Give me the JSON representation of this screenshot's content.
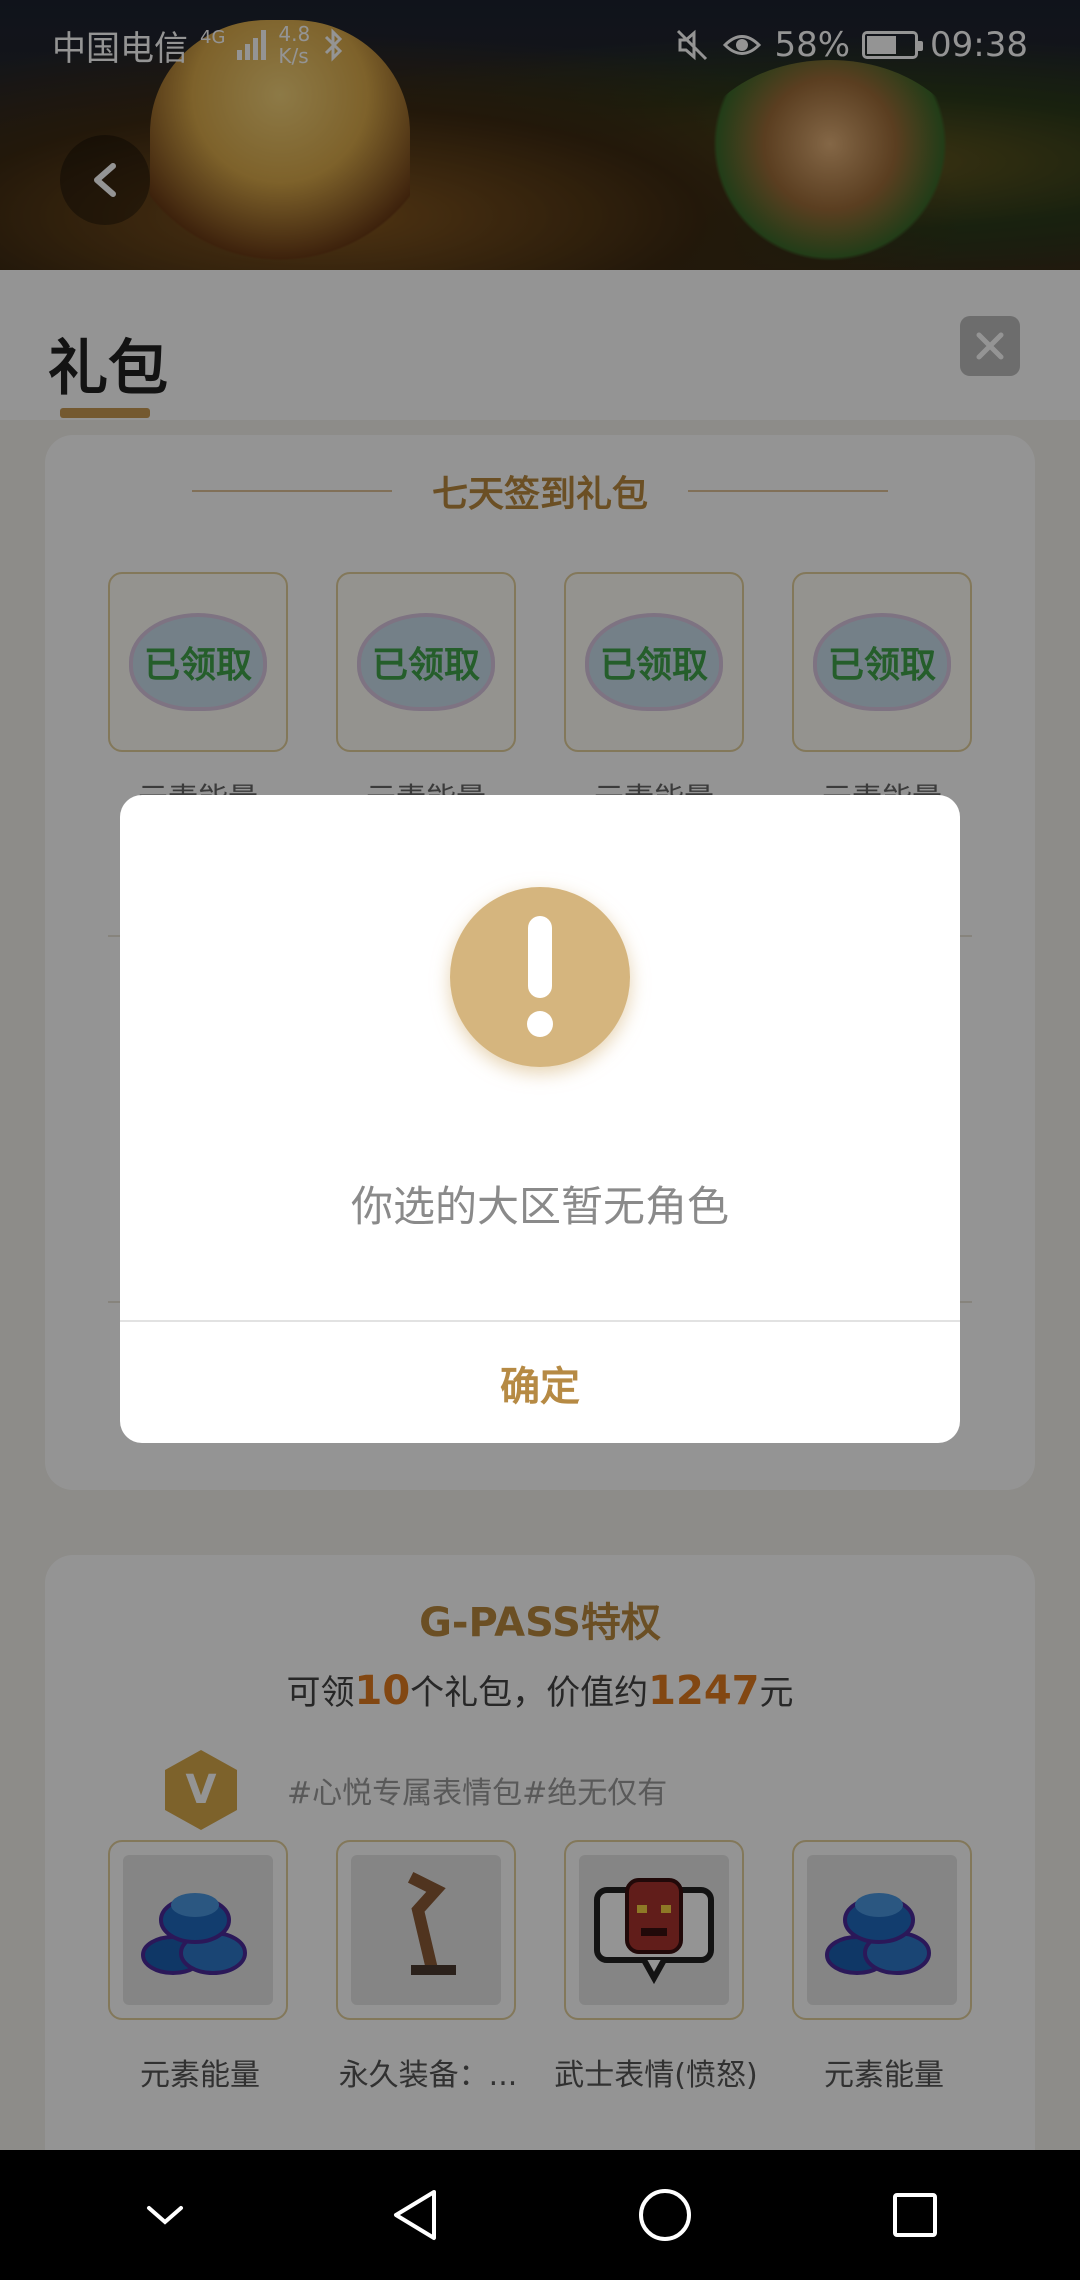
{
  "status_bar": {
    "carrier": "中国电信",
    "network_type": "4G",
    "net_speed_value": "4.8",
    "net_speed_unit": "K/s",
    "battery_percent": "58%",
    "battery_level": 0.58,
    "time": "09:38"
  },
  "sheet": {
    "title": "礼包"
  },
  "signin_section": {
    "title": "七天签到礼包",
    "rewards": [
      {
        "status": "已领取",
        "caption": "元素能量"
      },
      {
        "status": "已领取",
        "caption": "元素能量"
      },
      {
        "status": "已领取",
        "caption": "元素能量"
      },
      {
        "status": "已领取",
        "caption": "元素能量"
      }
    ]
  },
  "gpass_section": {
    "title": "G-PASS特权",
    "sub_prefix": "可领",
    "sub_count": "10",
    "sub_middle": "个礼包，价值约",
    "sub_value": "1247",
    "sub_suffix": "元",
    "vip_badge": "V",
    "vip_text": "#心悦专属表情包#绝无仅有",
    "items": [
      {
        "caption": "元素能量",
        "icon": "energy-coins-icon"
      },
      {
        "caption": "永久装备：...",
        "icon": "staff-weapon-icon"
      },
      {
        "caption": "武士表情(愤怒)",
        "icon": "samurai-emote-icon"
      },
      {
        "caption": "元素能量",
        "icon": "energy-coins-icon"
      }
    ]
  },
  "dialog": {
    "message": "你选的大区暂无角色",
    "confirm_label": "确定"
  },
  "colors": {
    "accent": "#b9893e",
    "alert_circle": "#d5b57e",
    "claimed_green": "#41a34a",
    "highlight_orange": "#e07b1f"
  }
}
